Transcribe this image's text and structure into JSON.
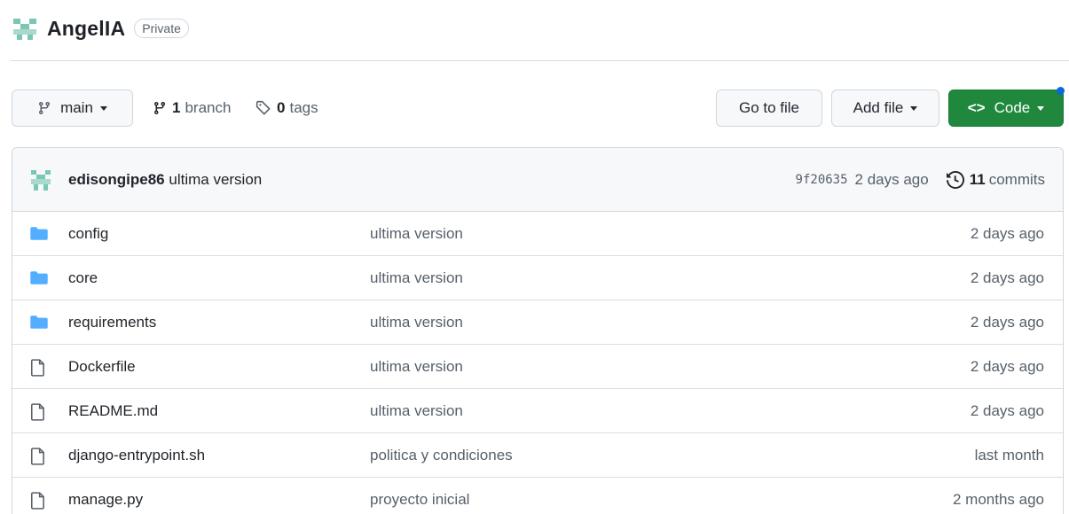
{
  "repo": {
    "name": "AngelIA",
    "visibility": "Private"
  },
  "toolbar": {
    "branch_name": "main",
    "branch_count": "1",
    "branch_label": "branch",
    "tag_count": "0",
    "tag_label": "tags",
    "go_to_file": "Go to file",
    "add_file": "Add file",
    "code": "Code"
  },
  "latest_commit": {
    "author": "edisongipe86",
    "message": "ultima version",
    "sha": "9f20635",
    "age": "2 days ago",
    "commit_count": "11",
    "commit_label": "commits"
  },
  "files": [
    {
      "type": "folder",
      "icon": "folder-icon",
      "name": "config",
      "message": "ultima version",
      "age": "2 days ago"
    },
    {
      "type": "folder",
      "icon": "folder-icon",
      "name": "core",
      "message": "ultima version",
      "age": "2 days ago"
    },
    {
      "type": "folder",
      "icon": "folder-icon",
      "name": "requirements",
      "message": "ultima version",
      "age": "2 days ago"
    },
    {
      "type": "file",
      "icon": "file-icon",
      "name": "Dockerfile",
      "message": "ultima version",
      "age": "2 days ago"
    },
    {
      "type": "file",
      "icon": "file-icon",
      "name": "README.md",
      "message": "ultima version",
      "age": "2 days ago"
    },
    {
      "type": "file",
      "icon": "file-icon",
      "name": "django-entrypoint.sh",
      "message": "politica y condiciones",
      "age": "last month"
    },
    {
      "type": "file",
      "icon": "file-icon",
      "name": "manage.py",
      "message": "proyecto inicial",
      "age": "2 months ago"
    }
  ],
  "colors": {
    "accent_green": "#1f883d",
    "folder_blue": "#54aeff",
    "notification_blue": "#0969da"
  }
}
